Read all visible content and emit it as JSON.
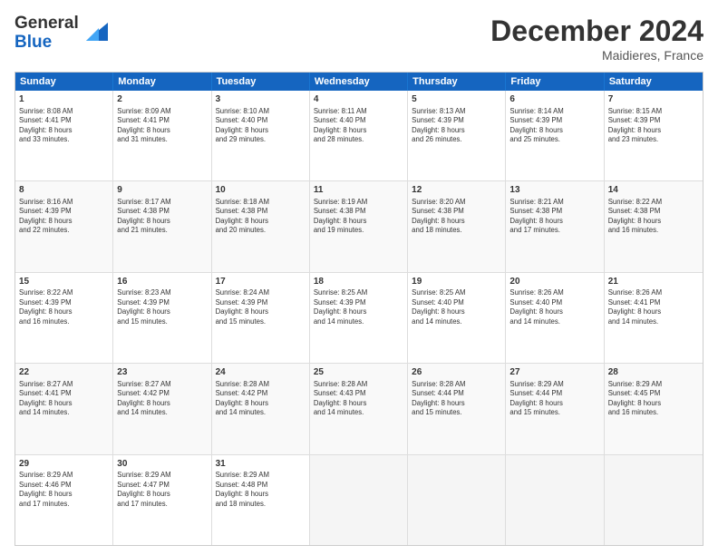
{
  "header": {
    "logo_line1": "General",
    "logo_line2": "Blue",
    "title": "December 2024",
    "location": "Maidieres, France"
  },
  "days_of_week": [
    "Sunday",
    "Monday",
    "Tuesday",
    "Wednesday",
    "Thursday",
    "Friday",
    "Saturday"
  ],
  "weeks": [
    [
      {
        "day": "1",
        "lines": [
          "Sunrise: 8:08 AM",
          "Sunset: 4:41 PM",
          "Daylight: 8 hours",
          "and 33 minutes."
        ]
      },
      {
        "day": "2",
        "lines": [
          "Sunrise: 8:09 AM",
          "Sunset: 4:41 PM",
          "Daylight: 8 hours",
          "and 31 minutes."
        ]
      },
      {
        "day": "3",
        "lines": [
          "Sunrise: 8:10 AM",
          "Sunset: 4:40 PM",
          "Daylight: 8 hours",
          "and 29 minutes."
        ]
      },
      {
        "day": "4",
        "lines": [
          "Sunrise: 8:11 AM",
          "Sunset: 4:40 PM",
          "Daylight: 8 hours",
          "and 28 minutes."
        ]
      },
      {
        "day": "5",
        "lines": [
          "Sunrise: 8:13 AM",
          "Sunset: 4:39 PM",
          "Daylight: 8 hours",
          "and 26 minutes."
        ]
      },
      {
        "day": "6",
        "lines": [
          "Sunrise: 8:14 AM",
          "Sunset: 4:39 PM",
          "Daylight: 8 hours",
          "and 25 minutes."
        ]
      },
      {
        "day": "7",
        "lines": [
          "Sunrise: 8:15 AM",
          "Sunset: 4:39 PM",
          "Daylight: 8 hours",
          "and 23 minutes."
        ]
      }
    ],
    [
      {
        "day": "8",
        "lines": [
          "Sunrise: 8:16 AM",
          "Sunset: 4:39 PM",
          "Daylight: 8 hours",
          "and 22 minutes."
        ]
      },
      {
        "day": "9",
        "lines": [
          "Sunrise: 8:17 AM",
          "Sunset: 4:38 PM",
          "Daylight: 8 hours",
          "and 21 minutes."
        ]
      },
      {
        "day": "10",
        "lines": [
          "Sunrise: 8:18 AM",
          "Sunset: 4:38 PM",
          "Daylight: 8 hours",
          "and 20 minutes."
        ]
      },
      {
        "day": "11",
        "lines": [
          "Sunrise: 8:19 AM",
          "Sunset: 4:38 PM",
          "Daylight: 8 hours",
          "and 19 minutes."
        ]
      },
      {
        "day": "12",
        "lines": [
          "Sunrise: 8:20 AM",
          "Sunset: 4:38 PM",
          "Daylight: 8 hours",
          "and 18 minutes."
        ]
      },
      {
        "day": "13",
        "lines": [
          "Sunrise: 8:21 AM",
          "Sunset: 4:38 PM",
          "Daylight: 8 hours",
          "and 17 minutes."
        ]
      },
      {
        "day": "14",
        "lines": [
          "Sunrise: 8:22 AM",
          "Sunset: 4:38 PM",
          "Daylight: 8 hours",
          "and 16 minutes."
        ]
      }
    ],
    [
      {
        "day": "15",
        "lines": [
          "Sunrise: 8:22 AM",
          "Sunset: 4:39 PM",
          "Daylight: 8 hours",
          "and 16 minutes."
        ]
      },
      {
        "day": "16",
        "lines": [
          "Sunrise: 8:23 AM",
          "Sunset: 4:39 PM",
          "Daylight: 8 hours",
          "and 15 minutes."
        ]
      },
      {
        "day": "17",
        "lines": [
          "Sunrise: 8:24 AM",
          "Sunset: 4:39 PM",
          "Daylight: 8 hours",
          "and 15 minutes."
        ]
      },
      {
        "day": "18",
        "lines": [
          "Sunrise: 8:25 AM",
          "Sunset: 4:39 PM",
          "Daylight: 8 hours",
          "and 14 minutes."
        ]
      },
      {
        "day": "19",
        "lines": [
          "Sunrise: 8:25 AM",
          "Sunset: 4:40 PM",
          "Daylight: 8 hours",
          "and 14 minutes."
        ]
      },
      {
        "day": "20",
        "lines": [
          "Sunrise: 8:26 AM",
          "Sunset: 4:40 PM",
          "Daylight: 8 hours",
          "and 14 minutes."
        ]
      },
      {
        "day": "21",
        "lines": [
          "Sunrise: 8:26 AM",
          "Sunset: 4:41 PM",
          "Daylight: 8 hours",
          "and 14 minutes."
        ]
      }
    ],
    [
      {
        "day": "22",
        "lines": [
          "Sunrise: 8:27 AM",
          "Sunset: 4:41 PM",
          "Daylight: 8 hours",
          "and 14 minutes."
        ]
      },
      {
        "day": "23",
        "lines": [
          "Sunrise: 8:27 AM",
          "Sunset: 4:42 PM",
          "Daylight: 8 hours",
          "and 14 minutes."
        ]
      },
      {
        "day": "24",
        "lines": [
          "Sunrise: 8:28 AM",
          "Sunset: 4:42 PM",
          "Daylight: 8 hours",
          "and 14 minutes."
        ]
      },
      {
        "day": "25",
        "lines": [
          "Sunrise: 8:28 AM",
          "Sunset: 4:43 PM",
          "Daylight: 8 hours",
          "and 14 minutes."
        ]
      },
      {
        "day": "26",
        "lines": [
          "Sunrise: 8:28 AM",
          "Sunset: 4:44 PM",
          "Daylight: 8 hours",
          "and 15 minutes."
        ]
      },
      {
        "day": "27",
        "lines": [
          "Sunrise: 8:29 AM",
          "Sunset: 4:44 PM",
          "Daylight: 8 hours",
          "and 15 minutes."
        ]
      },
      {
        "day": "28",
        "lines": [
          "Sunrise: 8:29 AM",
          "Sunset: 4:45 PM",
          "Daylight: 8 hours",
          "and 16 minutes."
        ]
      }
    ],
    [
      {
        "day": "29",
        "lines": [
          "Sunrise: 8:29 AM",
          "Sunset: 4:46 PM",
          "Daylight: 8 hours",
          "and 17 minutes."
        ]
      },
      {
        "day": "30",
        "lines": [
          "Sunrise: 8:29 AM",
          "Sunset: 4:47 PM",
          "Daylight: 8 hours",
          "and 17 minutes."
        ]
      },
      {
        "day": "31",
        "lines": [
          "Sunrise: 8:29 AM",
          "Sunset: 4:48 PM",
          "Daylight: 8 hours",
          "and 18 minutes."
        ]
      },
      null,
      null,
      null,
      null
    ]
  ]
}
